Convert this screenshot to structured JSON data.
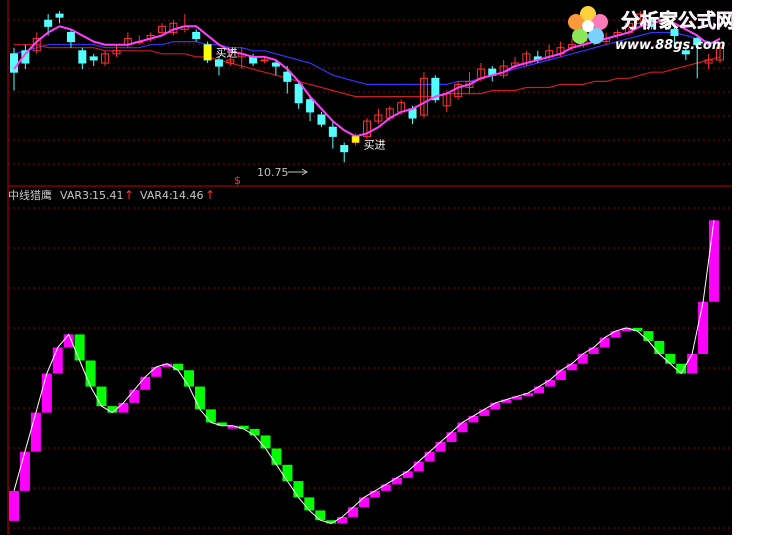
{
  "watermark": {
    "title": "分析家公式网",
    "url": "www.88gs.com"
  },
  "top_panel": {
    "buy_label": "买进",
    "low_price_label": "10.75",
    "dollar_marker": "$"
  },
  "indicator_panel": {
    "name": "中线猎鹰",
    "var3_label": "VAR3:",
    "var3_value": "15.41",
    "var4_label": "VAR4:",
    "var4_value": "14.46",
    "up_arrow": "↑"
  },
  "colors": {
    "background": "#000000",
    "grid": "#8b0000",
    "up_candle": "#ff3232",
    "down_candle": "#54ffff",
    "ma_fast": "#ff40ff",
    "ma_mid": "#3434ff",
    "ma_slow": "#c81e1e",
    "buy_marker": "#ffff00",
    "rise": "#ff00ff",
    "fall": "#00ff00",
    "indicator_line": "#ffffff"
  },
  "chart_data": [
    {
      "type": "candlestick",
      "description_series": [
        "price",
        "ma_fast",
        "ma_mid",
        "ma_slow"
      ],
      "grid": true,
      "price_range": [
        10.5,
        15.8
      ],
      "candles": [
        [
          14.3,
          13.7,
          14.5,
          13.1
        ],
        [
          14.4,
          14.0,
          14.6,
          13.8
        ],
        [
          14.4,
          14.8,
          15.0,
          14.3
        ],
        [
          15.4,
          15.2,
          15.6,
          14.9
        ],
        [
          15.6,
          15.5,
          15.7,
          15.3
        ],
        [
          15.0,
          14.7,
          15.1,
          14.5
        ],
        [
          14.4,
          14.0,
          14.5,
          13.8
        ],
        [
          14.2,
          14.1,
          14.3,
          13.9
        ],
        [
          14.0,
          14.3,
          14.4,
          13.9
        ],
        [
          14.3,
          14.4,
          14.6,
          14.2
        ],
        [
          14.6,
          14.8,
          15.0,
          14.5
        ],
        [
          14.7,
          14.7,
          14.9,
          14.6
        ],
        [
          14.8,
          14.9,
          15.0,
          14.7
        ],
        [
          15.0,
          15.2,
          15.3,
          14.9
        ],
        [
          15.0,
          15.3,
          15.4,
          14.9
        ],
        [
          15.1,
          15.2,
          15.6,
          15.0
        ],
        [
          15.0,
          14.8,
          15.1,
          14.7
        ],
        [
          14.6,
          14.1,
          14.7,
          14.0
        ],
        [
          14.1,
          13.9,
          14.2,
          13.6
        ],
        [
          14.0,
          14.1,
          14.3,
          13.9
        ],
        [
          14.2,
          14.3,
          14.5,
          13.8
        ],
        [
          14.2,
          14.0,
          14.3,
          13.9
        ],
        [
          14.1,
          14.1,
          14.2,
          14.0
        ],
        [
          14.0,
          13.9,
          14.1,
          13.6
        ],
        [
          13.7,
          13.4,
          13.9,
          13.0
        ],
        [
          13.3,
          12.7,
          13.4,
          12.5
        ],
        [
          12.8,
          12.4,
          12.9,
          12.1
        ],
        [
          12.3,
          12.0,
          12.4,
          11.9
        ],
        [
          11.9,
          11.6,
          12.1,
          11.2
        ],
        [
          11.3,
          11.1,
          11.4,
          10.75
        ],
        [
          11.4,
          11.6,
          11.7,
          11.3
        ],
        [
          11.6,
          12.1,
          12.2,
          11.5
        ],
        [
          12.1,
          12.3,
          12.5,
          12.0
        ],
        [
          12.2,
          12.5,
          12.6,
          12.1
        ],
        [
          12.4,
          12.7,
          12.8,
          12.3
        ],
        [
          12.5,
          12.2,
          12.6,
          12.0
        ],
        [
          12.3,
          13.5,
          13.7,
          12.2
        ],
        [
          13.5,
          12.8,
          13.6,
          12.7
        ],
        [
          12.6,
          13.0,
          13.1,
          12.4
        ],
        [
          12.9,
          13.3,
          13.4,
          12.8
        ],
        [
          13.2,
          13.4,
          13.7,
          13.0
        ],
        [
          13.5,
          13.8,
          14.0,
          13.4
        ],
        [
          13.8,
          13.6,
          13.9,
          13.4
        ],
        [
          13.6,
          13.9,
          14.1,
          13.5
        ],
        [
          13.9,
          14.0,
          14.2,
          13.8
        ],
        [
          14.0,
          14.3,
          14.4,
          13.9
        ],
        [
          14.2,
          14.1,
          14.4,
          14.0
        ],
        [
          14.2,
          14.4,
          14.6,
          14.1
        ],
        [
          14.3,
          14.5,
          14.7,
          14.2
        ],
        [
          14.5,
          14.6,
          14.8,
          14.4
        ],
        [
          14.6,
          14.9,
          15.0,
          14.5
        ],
        [
          14.8,
          14.7,
          14.9,
          14.6
        ],
        [
          14.7,
          14.8,
          15.0,
          14.6
        ],
        [
          14.9,
          15.0,
          15.1,
          14.8
        ],
        [
          15.0,
          15.3,
          15.5,
          14.9
        ],
        [
          15.3,
          15.6,
          15.7,
          15.2
        ],
        [
          15.4,
          15.2,
          15.5,
          15.1
        ],
        [
          15.3,
          15.5,
          15.6,
          15.2
        ],
        [
          15.1,
          14.9,
          15.2,
          14.5
        ],
        [
          14.4,
          14.3,
          14.5,
          14.1
        ],
        [
          14.8,
          14.6,
          14.9,
          13.5
        ],
        [
          14.0,
          14.1,
          14.3,
          13.8
        ],
        [
          14.1,
          14.5,
          14.6,
          14.0
        ]
      ],
      "ma_fast": [
        13.8,
        14.3,
        14.7,
        15.0,
        15.2,
        15.1,
        14.9,
        14.7,
        14.6,
        14.6,
        14.6,
        14.7,
        14.8,
        14.9,
        15.1,
        15.2,
        15.2,
        14.9,
        14.6,
        14.4,
        14.3,
        14.2,
        14.2,
        14.1,
        13.8,
        13.4,
        12.9,
        12.5,
        12.1,
        11.8,
        11.6,
        11.7,
        11.9,
        12.2,
        12.4,
        12.5,
        12.7,
        12.9,
        13.0,
        13.2,
        13.3,
        13.5,
        13.6,
        13.7,
        13.9,
        14.0,
        14.1,
        14.2,
        14.3,
        14.5,
        14.6,
        14.7,
        14.8,
        14.9,
        15.0,
        15.2,
        15.3,
        15.4,
        15.3,
        15.1,
        14.9,
        14.6,
        14.8
      ],
      "ma_mid": [
        14.3,
        14.4,
        14.5,
        14.6,
        14.6,
        14.6,
        14.6,
        14.6,
        14.5,
        14.5,
        14.5,
        14.5,
        14.6,
        14.6,
        14.7,
        14.7,
        14.7,
        14.6,
        14.6,
        14.5,
        14.5,
        14.4,
        14.4,
        14.3,
        14.2,
        14.1,
        14.0,
        13.8,
        13.6,
        13.5,
        13.4,
        13.3,
        13.3,
        13.3,
        13.3,
        13.3,
        13.3,
        13.3,
        13.3,
        13.4,
        13.4,
        13.5,
        13.6,
        13.7,
        13.8,
        13.9,
        14.0,
        14.1,
        14.2,
        14.3,
        14.4,
        14.5,
        14.6,
        14.7,
        14.8,
        14.9,
        15.0,
        15.0,
        15.0,
        14.9,
        14.8,
        14.7,
        14.6
      ],
      "ma_slow": [
        14.6,
        14.6,
        14.6,
        14.5,
        14.5,
        14.5,
        14.5,
        14.5,
        14.4,
        14.4,
        14.4,
        14.4,
        14.4,
        14.3,
        14.3,
        14.3,
        14.2,
        14.2,
        14.1,
        14.0,
        13.9,
        13.8,
        13.7,
        13.6,
        13.5,
        13.4,
        13.3,
        13.2,
        13.1,
        13.0,
        12.9,
        12.9,
        12.9,
        12.9,
        12.9,
        12.9,
        12.9,
        12.9,
        13.0,
        13.0,
        13.0,
        13.0,
        13.1,
        13.1,
        13.1,
        13.2,
        13.2,
        13.2,
        13.3,
        13.3,
        13.3,
        13.4,
        13.4,
        13.5,
        13.5,
        13.6,
        13.7,
        13.7,
        13.8,
        13.9,
        14.0,
        14.1,
        14.2
      ],
      "buy_signals": [
        {
          "index": 17,
          "label": "买进"
        },
        {
          "index": 30,
          "label": "买进"
        }
      ],
      "low_annotation": {
        "index": 29,
        "value": "10.75"
      }
    },
    {
      "type": "bar",
      "name": "中线猎鹰",
      "grid": true,
      "y_range": [
        0,
        100
      ],
      "values": [
        12,
        24,
        36,
        48,
        56,
        60,
        52,
        44,
        38,
        36,
        39,
        43,
        47,
        50,
        51,
        49,
        44,
        37,
        33,
        32,
        32,
        31,
        29,
        25,
        20,
        15,
        10,
        6,
        3,
        2,
        4,
        7,
        10,
        12,
        14,
        16,
        18,
        21,
        24,
        27,
        30,
        33,
        35,
        37,
        39,
        40,
        41,
        42,
        44,
        46,
        49,
        51,
        54,
        56,
        59,
        61,
        62,
        61,
        58,
        54,
        51,
        48,
        54,
        70,
        95
      ]
    }
  ]
}
